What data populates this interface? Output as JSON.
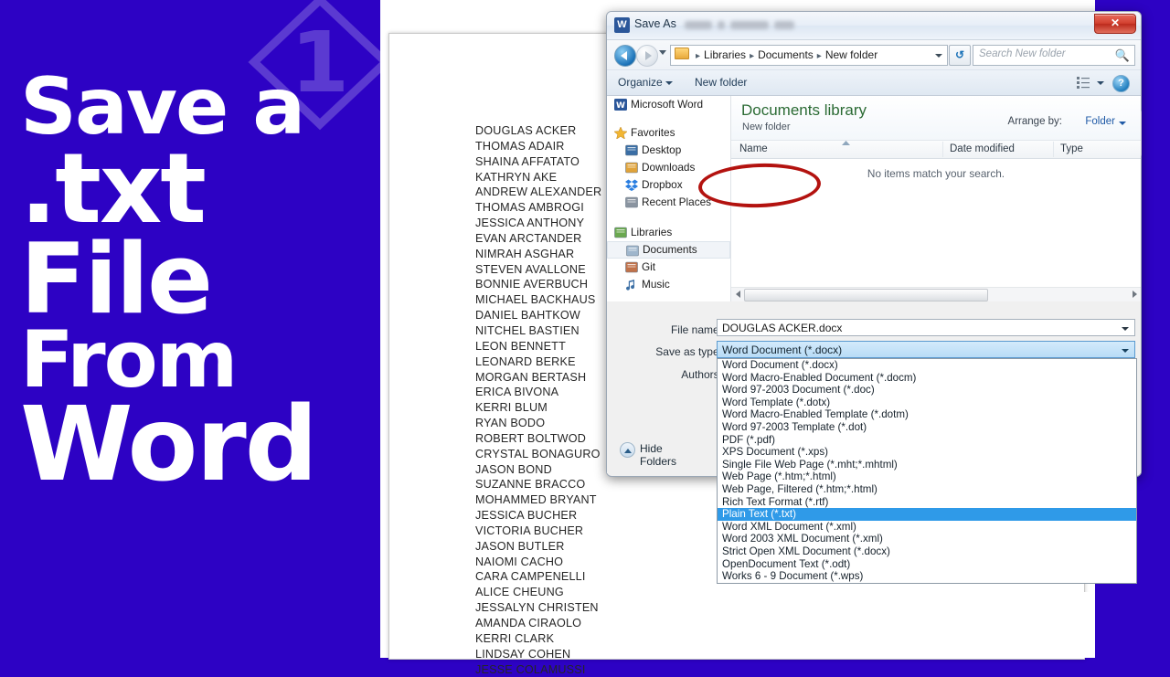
{
  "promo": {
    "line1": "Save a",
    "line2": ".txt",
    "line3": "File",
    "line4": "From",
    "line5": "Word",
    "background_color": "#2D02C4",
    "text_color": "#FFFFFF",
    "watermark_icon": "numeral-one-diamond-logo"
  },
  "document": {
    "names": [
      "DOUGLAS ACKER",
      "THOMAS ADAIR",
      "SHAINA AFFATATO",
      "KATHRYN AKE",
      "ANDREW ALEXANDER",
      "THOMAS AMBROGI",
      "JESSICA ANTHONY",
      "EVAN ARCTANDER",
      "NIMRAH ASGHAR",
      "STEVEN AVALLONE",
      "BONNIE AVERBUCH",
      "MICHAEL BACKHAUS",
      "DANIEL BAHTKOW",
      "NITCHEL BASTIEN",
      "LEON BENNETT",
      "LEONARD BERKE",
      "MORGAN BERTASH",
      "ERICA BIVONA",
      "KERRI BLUM",
      "RYAN BODO",
      "ROBERT BOLTWOD",
      "CRYSTAL BONAGURO",
      "JASON BOND",
      "SUZANNE BRACCO",
      "MOHAMMED BRYANT",
      "JESSICA BUCHER",
      "VICTORIA BUCHER",
      "JASON BUTLER",
      "NAIOMI CACHO",
      "CARA CAMPENELLI",
      "ALICE CHEUNG",
      "JESSALYN CHRISTEN",
      "AMANDA CIRAOLO",
      "KERRI CLARK",
      "LINDSAY COHEN",
      "JESSE COLAMUSSI"
    ]
  },
  "dialog": {
    "title": "Save As",
    "app_icon": "word-app-icon",
    "close_label": "✕",
    "address": {
      "back_icon": "back-arrow-icon",
      "forward_icon": "forward-arrow-icon",
      "folder_icon": "folder-icon",
      "crumbs": [
        "Libraries",
        "Documents",
        "New folder"
      ],
      "separator": "▶",
      "dropdown_icon": "chevron-down-icon",
      "refresh_icon": "refresh-icon",
      "refresh_glyph": "↺",
      "search_placeholder": "Search New folder",
      "search_icon": "search-icon"
    },
    "toolbar": {
      "organize": "Organize",
      "new_folder": "New folder",
      "views_icon": "view-options-icon",
      "help_icon": "help-icon",
      "help_glyph": "?"
    },
    "nav_pane": {
      "items": [
        {
          "label": "Microsoft Word",
          "icon": "word-app-icon",
          "level": "root",
          "selected": false
        },
        {
          "label": "Favorites",
          "icon": "star-icon",
          "level": "root",
          "selected": false
        },
        {
          "label": "Desktop",
          "icon": "desktop-icon",
          "level": "child",
          "selected": false
        },
        {
          "label": "Downloads",
          "icon": "downloads-folder-icon",
          "level": "child",
          "selected": false
        },
        {
          "label": "Dropbox",
          "icon": "dropbox-icon",
          "level": "child",
          "selected": false
        },
        {
          "label": "Recent Places",
          "icon": "recent-places-icon",
          "level": "child",
          "selected": false
        },
        {
          "label": "Libraries",
          "icon": "libraries-icon",
          "level": "root",
          "selected": false
        },
        {
          "label": "Documents",
          "icon": "documents-library-icon",
          "level": "child",
          "selected": true
        },
        {
          "label": "Git",
          "icon": "git-library-icon",
          "level": "child",
          "selected": false
        },
        {
          "label": "Music",
          "icon": "music-library-icon",
          "level": "child",
          "selected": false
        }
      ]
    },
    "file_list": {
      "library_title": "Documents library",
      "library_subtitle": "New folder",
      "arrange_label": "Arrange by:",
      "arrange_value": "Folder",
      "columns": [
        "Name",
        "Date modified",
        "Type"
      ],
      "empty_message": "No items match your search."
    },
    "form": {
      "file_name_label": "File name:",
      "file_name_value": "DOUGLAS ACKER.docx",
      "save_as_type_label": "Save as type:",
      "save_as_type_value": "Word Document (*.docx)",
      "authors_label": "Authors:",
      "hide_folders_label": "Hide Folders"
    },
    "save_as_type_options": [
      {
        "label": "Word Document (*.docx)",
        "selected": false
      },
      {
        "label": "Word Macro-Enabled Document (*.docm)",
        "selected": false
      },
      {
        "label": "Word 97-2003 Document (*.doc)",
        "selected": false
      },
      {
        "label": "Word Template (*.dotx)",
        "selected": false
      },
      {
        "label": "Word Macro-Enabled Template (*.dotm)",
        "selected": false
      },
      {
        "label": "Word 97-2003 Template (*.dot)",
        "selected": false
      },
      {
        "label": "PDF (*.pdf)",
        "selected": false
      },
      {
        "label": "XPS Document (*.xps)",
        "selected": false
      },
      {
        "label": "Single File Web Page (*.mht;*.mhtml)",
        "selected": false
      },
      {
        "label": "Web Page (*.htm;*.html)",
        "selected": false
      },
      {
        "label": "Web Page, Filtered (*.htm;*.html)",
        "selected": false
      },
      {
        "label": "Rich Text Format (*.rtf)",
        "selected": false
      },
      {
        "label": "Plain Text (*.txt)",
        "selected": true
      },
      {
        "label": "Word XML Document (*.xml)",
        "selected": false
      },
      {
        "label": "Word 2003 XML Document (*.xml)",
        "selected": false
      },
      {
        "label": "Strict Open XML Document (*.docx)",
        "selected": false
      },
      {
        "label": "OpenDocument Text (*.odt)",
        "selected": false
      },
      {
        "label": "Works 6 - 9 Document (*.wps)",
        "selected": false
      }
    ],
    "annotation": {
      "shape": "red-ellipse-highlight",
      "color": "#B3120F",
      "targets": "Plain Text (*.txt)"
    }
  }
}
